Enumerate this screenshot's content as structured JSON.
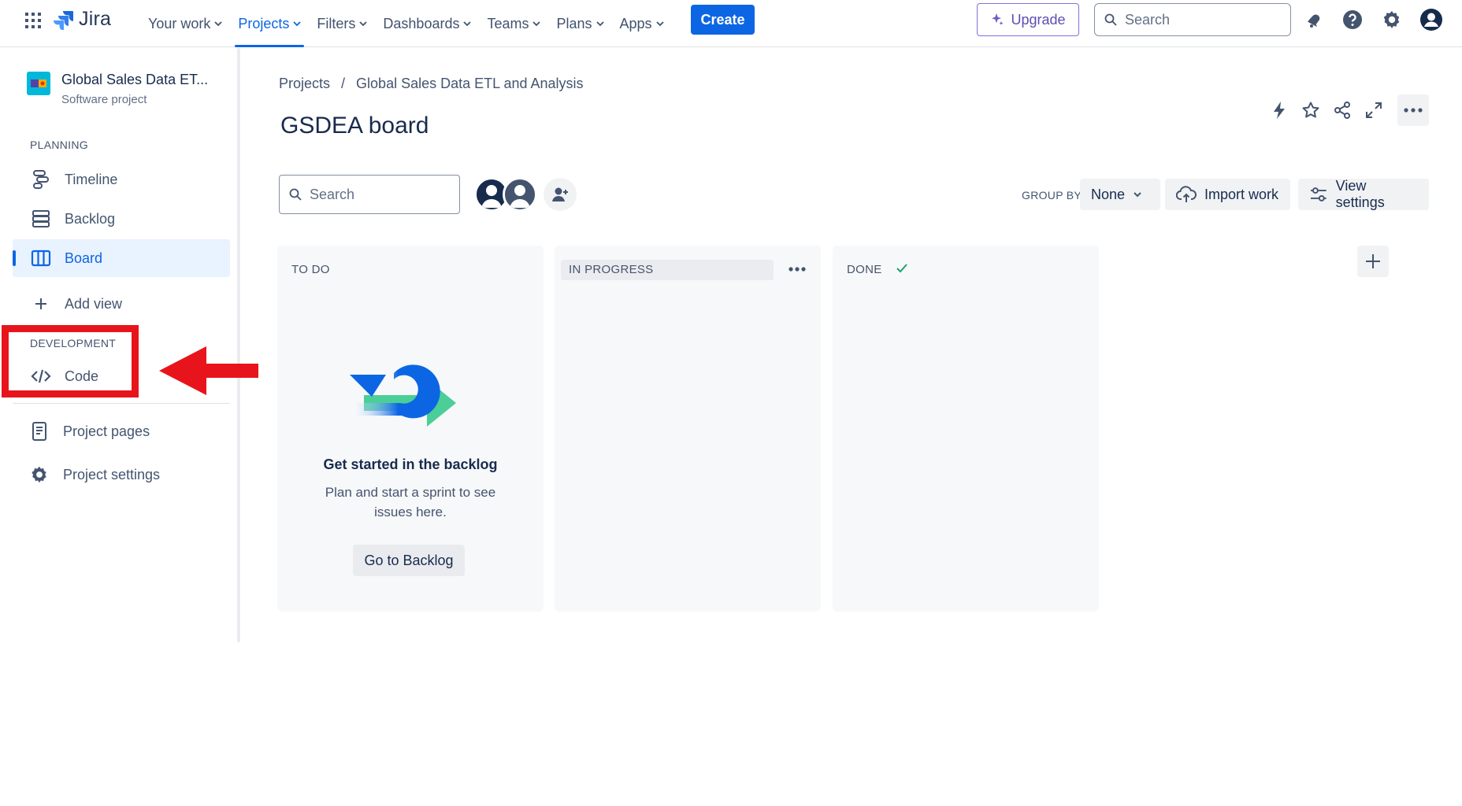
{
  "topnav": {
    "logo_text": "Jira",
    "menu": [
      {
        "label": "Your work"
      },
      {
        "label": "Projects"
      },
      {
        "label": "Filters"
      },
      {
        "label": "Dashboards"
      },
      {
        "label": "Teams"
      },
      {
        "label": "Plans"
      },
      {
        "label": "Apps"
      }
    ],
    "active_menu": "Projects",
    "create_label": "Create",
    "upgrade_label": "Upgrade",
    "search_placeholder": "Search",
    "icons": [
      "app-switcher-icon",
      "notifications-icon",
      "help-icon",
      "settings-icon",
      "profile-icon"
    ]
  },
  "sidebar": {
    "project_name": "Global Sales Data ET...",
    "project_type": "Software project",
    "planning_label": "PLANNING",
    "planning_items": [
      {
        "label": "Timeline",
        "icon": "timeline-icon"
      },
      {
        "label": "Backlog",
        "icon": "backlog-icon"
      },
      {
        "label": "Board",
        "icon": "board-icon"
      }
    ],
    "active_item": "Board",
    "add_view_label": "Add view",
    "development_label": "DEVELOPMENT",
    "development_items": [
      {
        "label": "Code",
        "icon": "code-icon"
      }
    ],
    "footer_items": [
      {
        "label": "Project pages",
        "icon": "page-icon"
      },
      {
        "label": "Project settings",
        "icon": "gear-icon"
      }
    ]
  },
  "annotation": {
    "color": "#e8141b"
  },
  "main": {
    "breadcrumb": [
      "Projects",
      "Global Sales Data ETL and Analysis"
    ],
    "breadcrumb_sep": "/",
    "title": "GSDEA board",
    "search_placeholder": "Search",
    "group_by_label": "GROUP BY",
    "group_by_value": "None",
    "import_label": "Import work",
    "view_settings_label": "View settings",
    "columns": [
      {
        "title": "TO DO"
      },
      {
        "title": "IN PROGRESS"
      },
      {
        "title": "DONE"
      }
    ],
    "empty_state": {
      "title": "Get started in the backlog",
      "text": "Plan and start a sprint to see issues here.",
      "button": "Go to Backlog"
    }
  },
  "colors": {
    "accent": "#0c66e4",
    "upgrade": "#5e4db2",
    "annotation": "#e8141b"
  }
}
